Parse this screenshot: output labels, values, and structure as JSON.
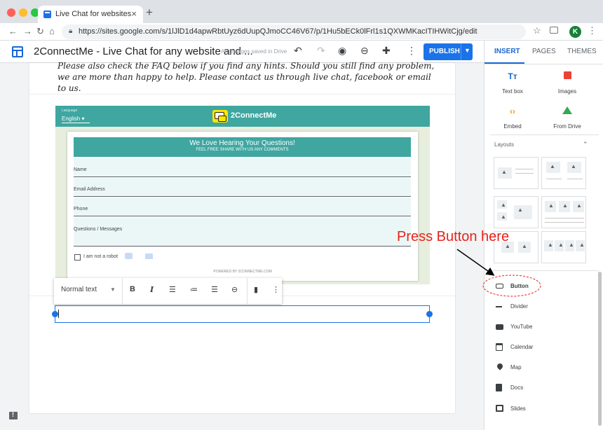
{
  "browser": {
    "tab_title": "Live Chat for websites",
    "tab_close": "×",
    "new_tab": "+",
    "url": "https://sites.google.com/s/1lJlD1d4apwRbtUyz6dUupQJmoCC46V67/p/1Hu5bECk0lFrl1s1QXWMKacITIHWitCjg/edit",
    "profile_initial": "K"
  },
  "sites_toolbar": {
    "doc_title": "2ConnectMe - Live Chat for any website and ...",
    "save_status": "All changes saved in Drive",
    "publish_label": "PUBLISH"
  },
  "right_panel": {
    "tabs": [
      "INSERT",
      "PAGES",
      "THEMES"
    ],
    "insert_tiles": [
      {
        "label": "Text box",
        "icon": "text-box-icon"
      },
      {
        "label": "Images",
        "icon": "image-icon"
      },
      {
        "label": "Embed",
        "icon": "embed-icon"
      },
      {
        "label": "From Drive",
        "icon": "drive-icon"
      }
    ],
    "layouts_label": "Layouts",
    "components": [
      {
        "label": "Button",
        "icon": "button-icon"
      },
      {
        "label": "Divider",
        "icon": "divider-icon"
      },
      {
        "label": "YouTube",
        "icon": "youtube-icon"
      },
      {
        "label": "Calendar",
        "icon": "calendar-icon"
      },
      {
        "label": "Map",
        "icon": "map-icon"
      },
      {
        "label": "Docs",
        "icon": "docs-icon"
      },
      {
        "label": "Slides",
        "icon": "slides-icon"
      }
    ]
  },
  "canvas": {
    "intro_text": "Please also check the FAQ below if you find any hints. Should you still find any problem, we are more than happy to help. Please contact us through live chat, facebook or email to us.",
    "chat_embed": {
      "language_label": "Language",
      "language_value": "English",
      "brand_name": "2ConnectMe",
      "banner_title": "We Love Hearing Your Questions!",
      "banner_subtitle": "FEEL FREE SHARE WITH US ANY COMMENTS",
      "fields": [
        "Name",
        "Email Address",
        "Phone",
        "Questions / Messages"
      ],
      "captcha_label": "I am not a robot",
      "powered_by": "POWERED BY 2CONNECTME.COM"
    },
    "text_toolbar": {
      "style_value": "Normal text"
    }
  },
  "annotation": {
    "text": "Press Button here",
    "color": "#e8221c"
  }
}
